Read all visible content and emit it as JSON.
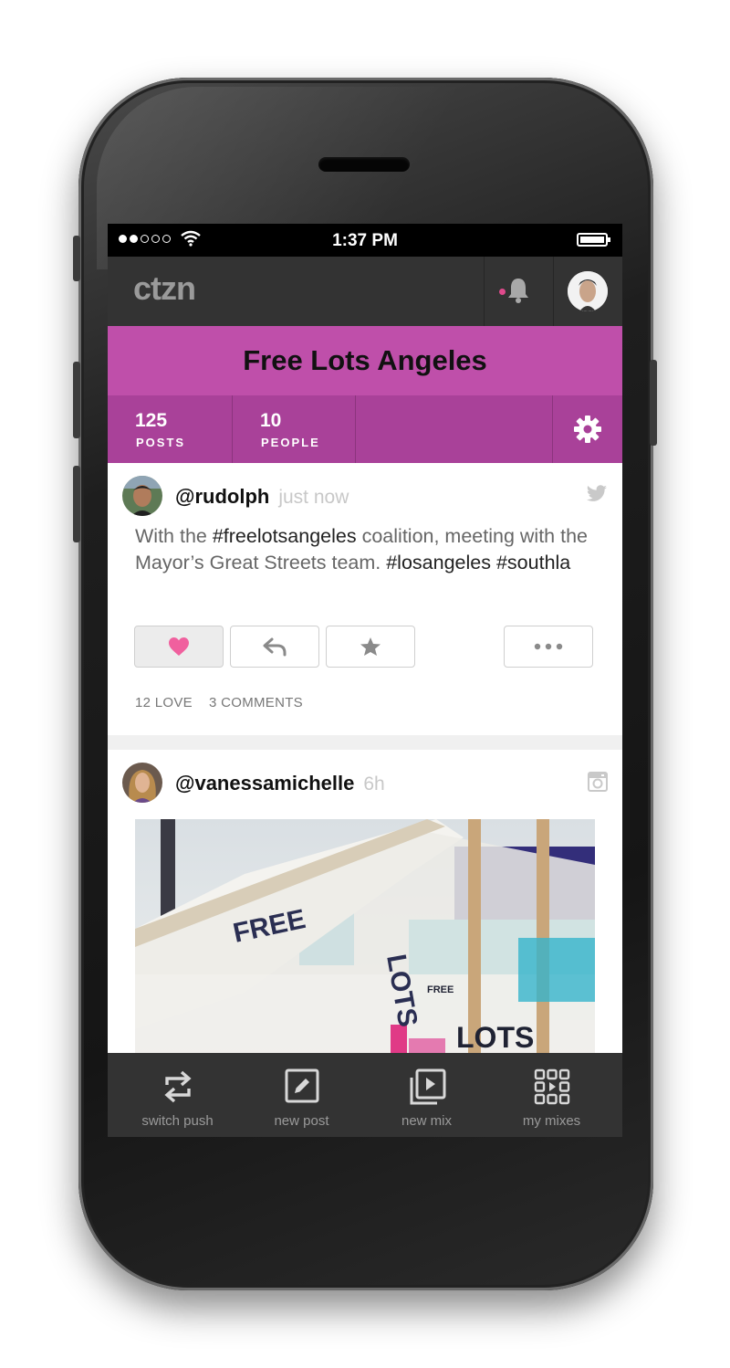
{
  "status_bar": {
    "time": "1:37 PM"
  },
  "app": {
    "logo": "ctzn"
  },
  "group": {
    "name": "Free Lots Angeles",
    "stats": [
      {
        "value": "125",
        "label": "POSTS"
      },
      {
        "value": "10",
        "label": "PEOPLE"
      }
    ]
  },
  "posts": [
    {
      "handle": "@rudolph",
      "time": "just now",
      "source_icon": "twitter-icon",
      "text_parts": {
        "p1": "With the ",
        "t1": "#freelotsangeles",
        "p2": " coalition, meeting with the Mayor’s Great Streets team. ",
        "t2": "#losangeles",
        "p3": " ",
        "t3": "#southla"
      },
      "love_count": "12 LOVE",
      "comment_count": "3 COMMENTS"
    },
    {
      "handle": "@vanessamichelle",
      "time": "6h",
      "source_icon": "instagram-icon",
      "photo_text": {
        "a": "FREE",
        "b": "LOTS",
        "c": "LOTS",
        "d": "FREE"
      }
    }
  ],
  "tabs": [
    {
      "label": "switch push",
      "icon": "switch-icon"
    },
    {
      "label": "new post",
      "icon": "edit-icon"
    },
    {
      "label": "new mix",
      "icon": "mix-icon"
    },
    {
      "label": "my mixes",
      "icon": "grid-icon"
    }
  ],
  "colors": {
    "group_header": "#bf4faa",
    "stats_bar": "#a94199",
    "app_bar": "#333333",
    "love_pink": "#f0609e"
  }
}
